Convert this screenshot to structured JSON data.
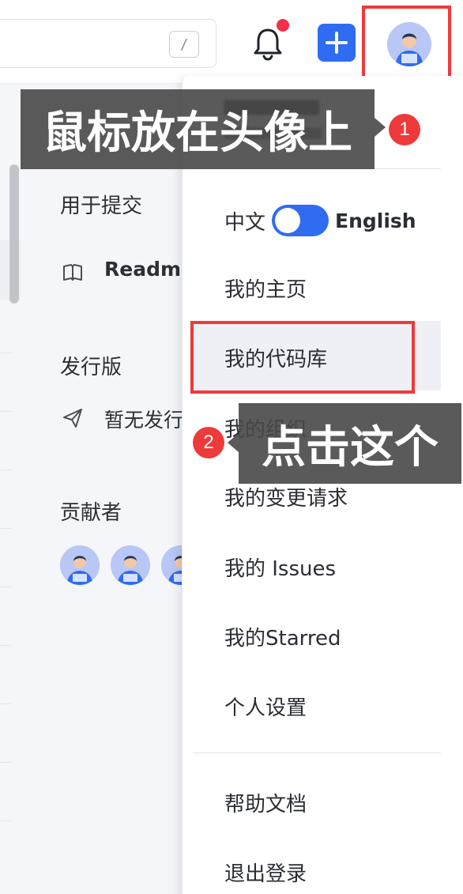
{
  "header": {
    "search_shortcut": "/",
    "has_notification": true,
    "accent_color": "#2f6cf2",
    "icons": [
      "search-shortcut",
      "bell-icon",
      "plus-icon",
      "avatar"
    ]
  },
  "sidebar": {
    "sections": {
      "commit_label": "用于提交",
      "release_label": "发行版",
      "contributors_label": "贡献者"
    },
    "readme_label": "Readme",
    "no_release_label": "暂无发行"
  },
  "user_menu": {
    "language_toggle": {
      "left_label": "中文",
      "right_label": "English",
      "active": "English"
    },
    "items": [
      {
        "label": "我的主页"
      },
      {
        "label": "我的代码库"
      },
      {
        "label": "我的组织"
      },
      {
        "label": "我的变更请求"
      },
      {
        "label": "我的 Issues"
      },
      {
        "label": "我的Starred"
      },
      {
        "label": "个人设置"
      }
    ],
    "footer_items": [
      {
        "label": "帮助文档"
      },
      {
        "label": "退出登录"
      }
    ]
  },
  "annotations": {
    "step1": {
      "number": "1",
      "text": "鼠标放在头像上"
    },
    "step2": {
      "number": "2",
      "text": "点击这个"
    },
    "highlight_color": "#ee3a3a"
  }
}
